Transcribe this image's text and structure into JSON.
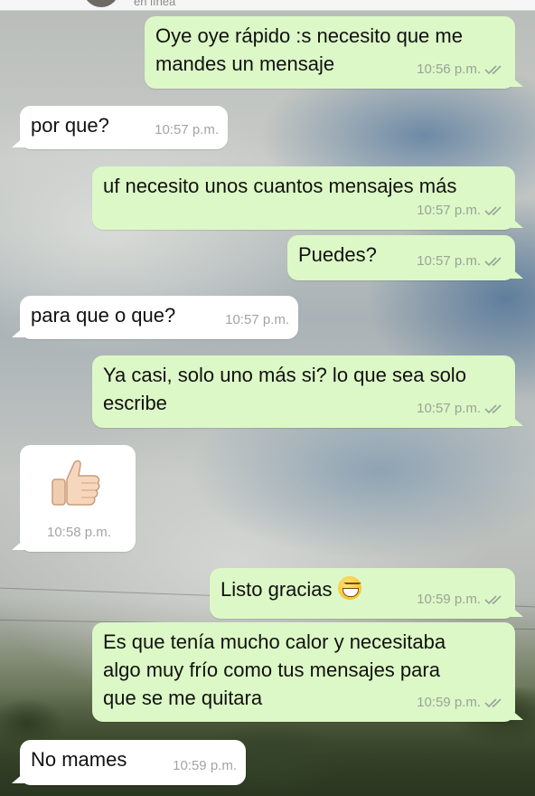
{
  "header": {
    "status_text": "en línea"
  },
  "messages": [
    {
      "direction": "outgoing",
      "lines": [
        "Oye oye rápido :s necesito que me",
        "mandes un mensaje"
      ],
      "time": "10:56 p.m.",
      "read_receipt": "double-check-icon"
    },
    {
      "direction": "incoming",
      "lines": [
        "por que?"
      ],
      "time": "10:57 p.m."
    },
    {
      "direction": "outgoing",
      "lines": [
        "uf necesito unos cuantos mensajes más"
      ],
      "time": "10:57 p.m.",
      "read_receipt": "double-check-icon"
    },
    {
      "direction": "outgoing",
      "lines": [
        "Puedes?"
      ],
      "time": "10:57 p.m.",
      "read_receipt": "double-check-icon"
    },
    {
      "direction": "incoming",
      "lines": [
        "para que o que?"
      ],
      "time": "10:57 p.m."
    },
    {
      "direction": "outgoing",
      "lines": [
        "Ya casi, solo uno más si? lo que sea solo",
        "escribe"
      ],
      "time": "10:57 p.m.",
      "read_receipt": "double-check-icon"
    },
    {
      "direction": "incoming",
      "emoji": "thumbs-up-icon",
      "time": "10:58 p.m."
    },
    {
      "direction": "outgoing",
      "lines": [
        "Listo gracias"
      ],
      "emoji": "grinning-face-icon",
      "time": "10:59 p.m.",
      "read_receipt": "double-check-icon"
    },
    {
      "direction": "outgoing",
      "lines": [
        "Es que tenía mucho calor y necesitaba",
        "algo muy frío como tus mensajes para",
        "que se me quitara"
      ],
      "time": "10:59 p.m.",
      "read_receipt": "double-check-icon"
    },
    {
      "direction": "incoming",
      "lines": [
        "No mames"
      ],
      "time": "10:59 p.m."
    }
  ],
  "colors": {
    "outgoing_bubble": "#dcf8c6",
    "incoming_bubble": "#ffffff",
    "timestamp": "#9aa39a",
    "read_ticks": "#9aa39a"
  }
}
